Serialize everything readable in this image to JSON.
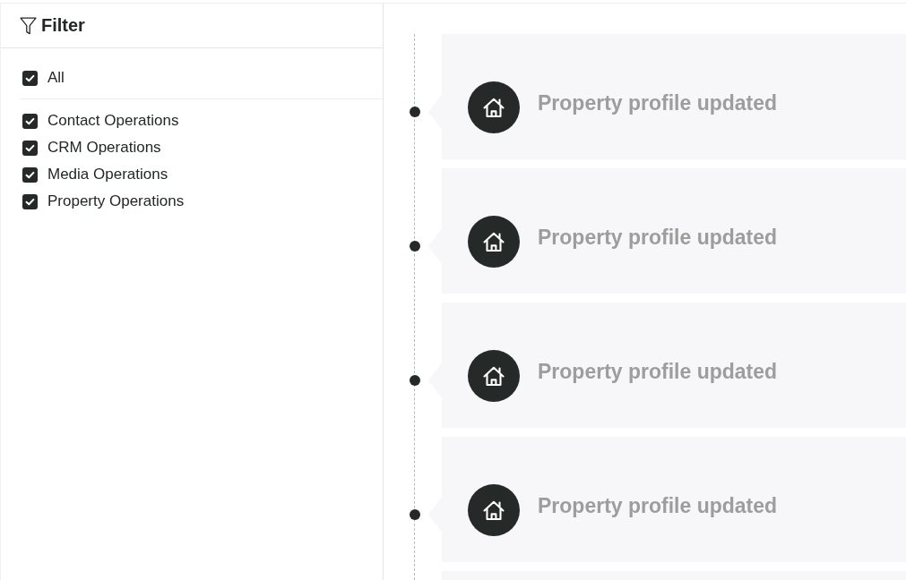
{
  "filter_panel": {
    "title": "Filter",
    "all": {
      "label": "All",
      "checked": true
    },
    "options": [
      {
        "label": "Contact Operations",
        "checked": true
      },
      {
        "label": "CRM Operations",
        "checked": true
      },
      {
        "label": "Media Operations",
        "checked": true
      },
      {
        "label": "Property Operations",
        "checked": true
      }
    ]
  },
  "timeline": {
    "events": [
      {
        "title": "Property profile updated"
      },
      {
        "title": "Property profile updated"
      },
      {
        "title": "Property profile updated"
      },
      {
        "title": "Property profile updated"
      }
    ]
  }
}
